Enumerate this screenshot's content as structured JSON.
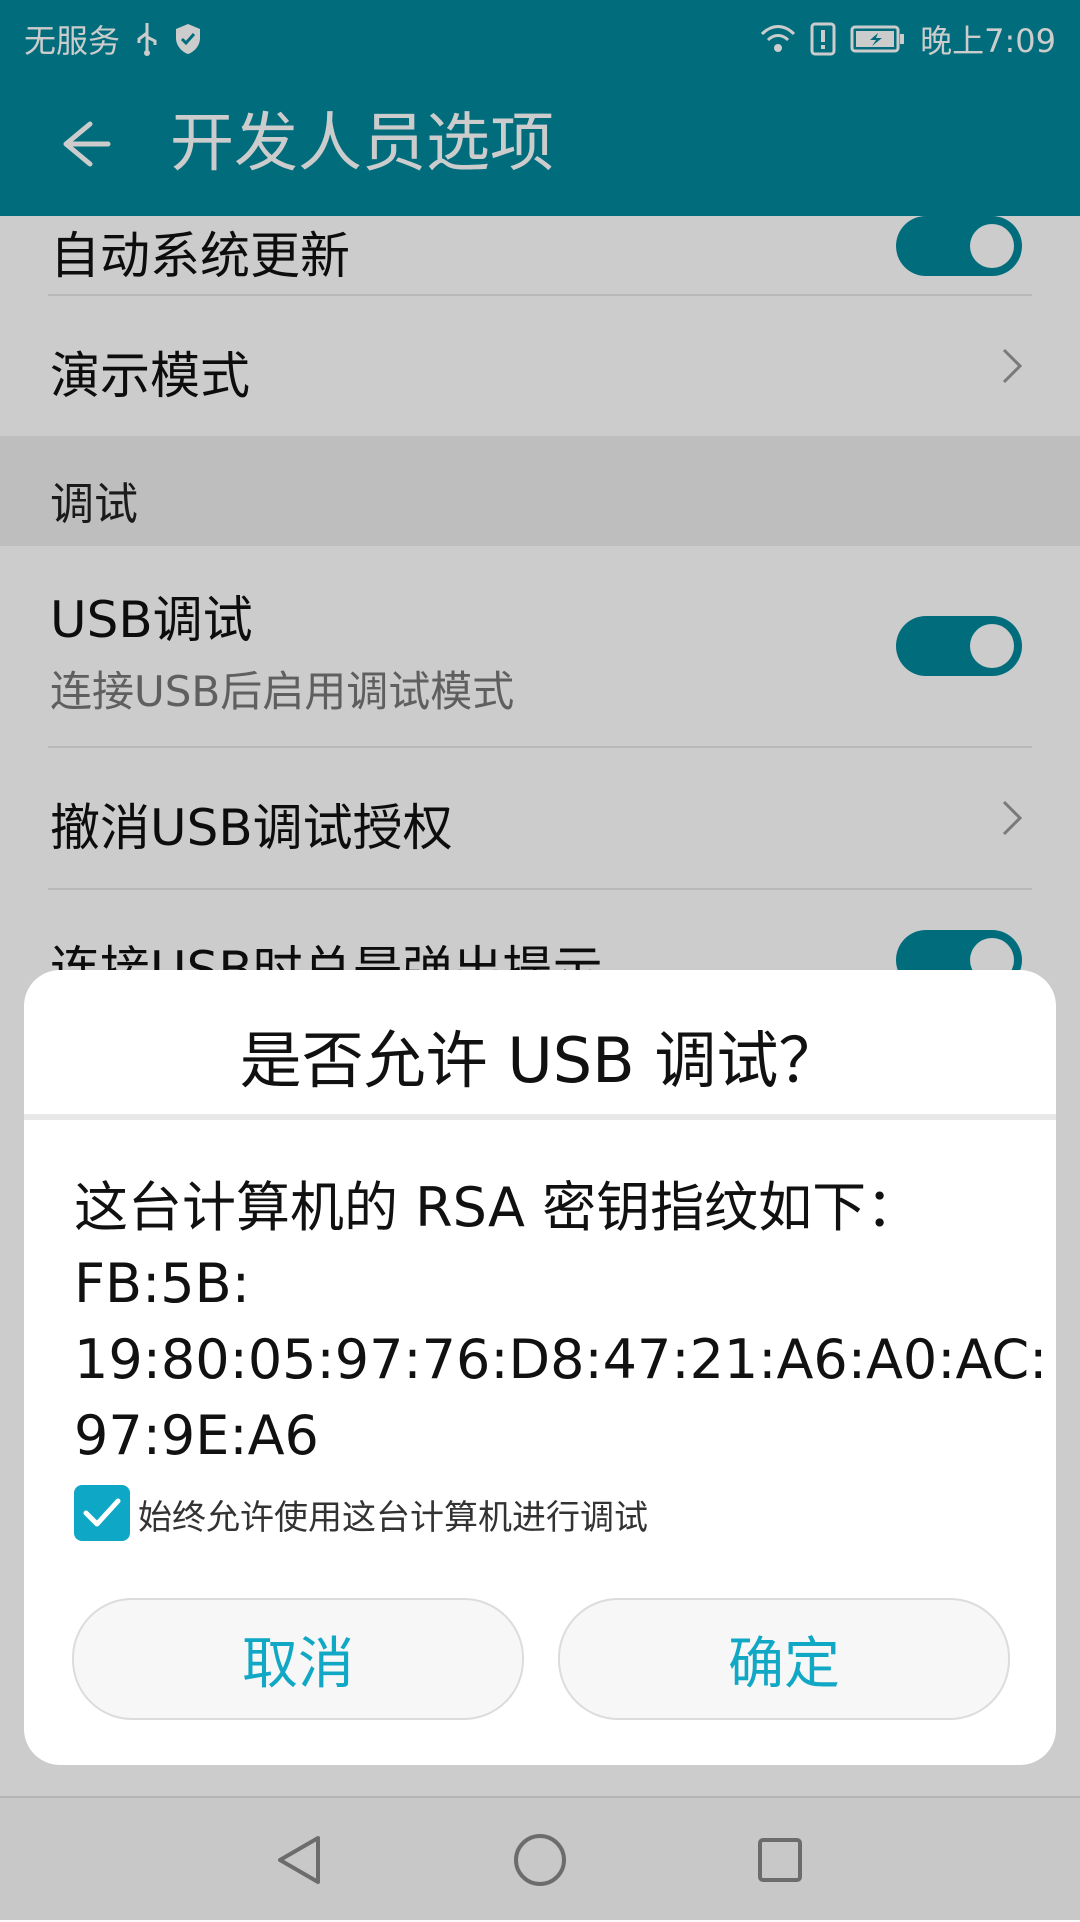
{
  "status_bar": {
    "carrier": "无服务",
    "time": "晚上7:09",
    "icons_left": [
      "usb-icon",
      "shield-icon"
    ],
    "icons_right": [
      "wifi-icon",
      "alert-sim-icon",
      "battery-icon"
    ]
  },
  "app_bar": {
    "title": "开发人员选项"
  },
  "settings": {
    "auto_update": {
      "label": "自动系统更新",
      "enabled": true
    },
    "demo_mode": {
      "label": "演示模式"
    },
    "section_debug": {
      "label": "调试"
    },
    "usb_debug": {
      "label": "USB调试",
      "subtitle": "连接USB后启用调试模式",
      "enabled": true
    },
    "revoke_usb_auth": {
      "label": "撤消USB调试授权"
    },
    "usb_prompt": {
      "label": "连接USB时总是弹出提示",
      "enabled": true
    }
  },
  "dialog": {
    "title": "是否允许 USB 调试？",
    "message_line1": "这台计算机的 RSA 密钥指纹如下：",
    "message_line2": "FB:5B:",
    "message_line3": "19:80:05:97:76:D8:47:21:A6:A0:AC:",
    "message_line4": "97:9E:A6",
    "checkbox_label": "始终允许使用这台计算机进行调试",
    "checkbox_checked": true,
    "cancel_label": "取消",
    "confirm_label": "确定"
  },
  "colors": {
    "primary": "#00889c",
    "accent": "#11a8c6"
  }
}
